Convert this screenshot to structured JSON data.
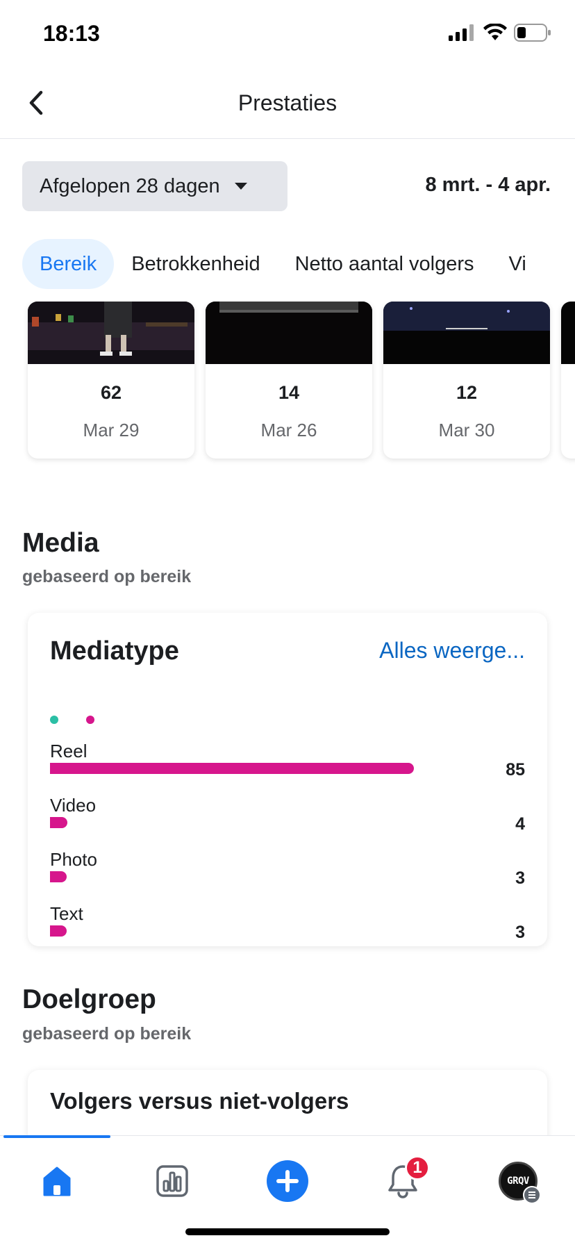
{
  "status_bar": {
    "time": "18:13"
  },
  "header": {
    "title": "Prestaties"
  },
  "filter": {
    "range_label": "Afgelopen 28 dagen",
    "date_range": "8 mrt. - 4 apr."
  },
  "tabs": [
    {
      "label": "Bereik",
      "active": true
    },
    {
      "label": "Betrokkenheid",
      "active": false
    },
    {
      "label": "Netto aantal volgers",
      "active": false
    },
    {
      "label": "Vi",
      "active": false
    }
  ],
  "top_content": [
    {
      "value": "62",
      "date": "Mar 29"
    },
    {
      "value": "14",
      "date": "Mar 26"
    },
    {
      "value": "12",
      "date": "Mar 30"
    }
  ],
  "media_section": {
    "title": "Media",
    "subtitle": "gebaseerd op bereik",
    "card": {
      "title": "Mediatype",
      "see_all": "Alles weerge...",
      "legend_colors": [
        "#2bbfa5",
        "#d6168c"
      ],
      "bar_color": "#d6168c",
      "rows": [
        {
          "label": "Reel",
          "value": "85",
          "fraction": 1.0
        },
        {
          "label": "Video",
          "value": "4",
          "fraction": 0.047
        },
        {
          "label": "Photo",
          "value": "3",
          "fraction": 0.035
        },
        {
          "label": "Text",
          "value": "3",
          "fraction": 0.035
        }
      ]
    }
  },
  "audience_section": {
    "title": "Doelgroep",
    "subtitle": "gebaseerd op bereik",
    "card_title": "Volgers versus niet-volgers"
  },
  "bottom_nav": {
    "items": [
      "home-icon",
      "insights-icon",
      "create-icon",
      "notifications-icon",
      "profile-avatar"
    ],
    "notification_count": "1",
    "avatar_text": "GRQV",
    "accent": "#1877f2"
  }
}
